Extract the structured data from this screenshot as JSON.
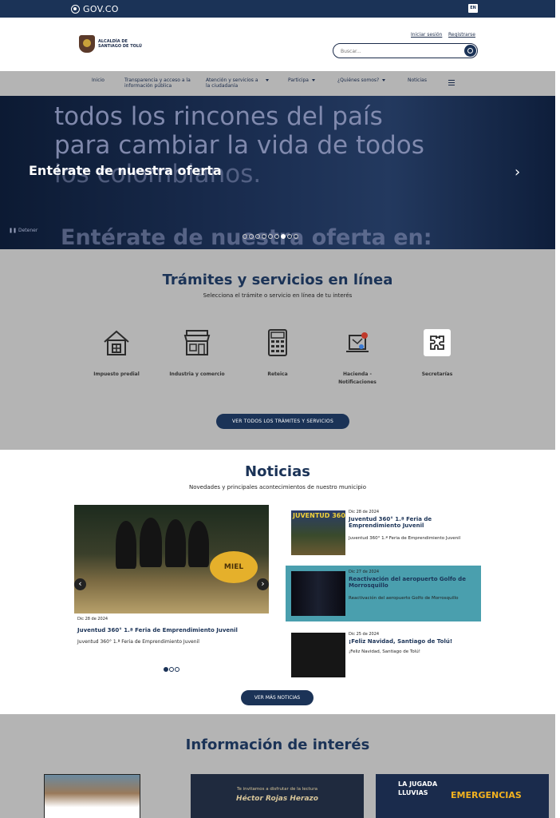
{
  "govbar": {
    "logo_text": "GOV.CO",
    "lang": "EN"
  },
  "header": {
    "logo_line1": "ALCALDÍA DE",
    "logo_line2": "SANTIAGO DE TOLÚ",
    "login": "Iniciar sesión",
    "register": "Registrarse",
    "search_placeholder": "Buscar..."
  },
  "nav": {
    "items": [
      {
        "label": "Inicio"
      },
      {
        "label": "Transparencia y acceso a la información pública"
      },
      {
        "label": "Atención y servicios a la ciudadanía"
      },
      {
        "label": "Participa"
      },
      {
        "label": "¿Quiénes somos?"
      },
      {
        "label": "Noticias"
      }
    ]
  },
  "hero": {
    "bg_line1": "todos los rincones del país",
    "bg_line2": "para cambiar la vida de todos",
    "bg_line3": "los colombianos.",
    "bg_line4": "Entérate de nuestra oferta en:",
    "title": "Entérate de nuestra oferta",
    "stop_label": "Detener",
    "slides": 9,
    "active_slide": 6
  },
  "tramites": {
    "title": "Trámites y servicios en línea",
    "subtitle": "Selecciona el trámite o servicio en línea de tu interés",
    "services": [
      {
        "label": "Impuesto predial",
        "icon": "house-icon"
      },
      {
        "label": "Industria y comercio",
        "icon": "store-icon"
      },
      {
        "label": "Reteica",
        "icon": "calculator-icon"
      },
      {
        "label": "Hacienda - Notificaciones",
        "icon": "notification-icon"
      },
      {
        "label": "Secretarías",
        "icon": "puzzle-icon"
      }
    ],
    "button": "VER TODOS LOS TRÁMITES Y SERVICIOS"
  },
  "noticias": {
    "title": "Noticias",
    "subtitle": "Novedades y principales acontecimientos de nuestro municipio",
    "main": {
      "date": "Dic 28 de 2024",
      "title": "Juventud 360° 1.ª Feria de Emprendimiento Juvenil",
      "desc": "Juventud 360° 1.ª Feria de Emprendimiento Juvenil",
      "sign": "MIEL"
    },
    "side": [
      {
        "date": "Dic 28 de 2024",
        "title": "Juventud 360° 1.ª Feria de Emprendimiento Juvenil",
        "desc": "Juventud 360° 1.ª Feria de Emprendimiento Juvenil",
        "thumb_text": "JUVENTUD 360"
      },
      {
        "date": "Dic 27 de 2024",
        "title": "Reactivación del aeropuerto Golfo de Morrosquillo",
        "desc": "Reactivación del aeropuerto Golfo de Morrosquillo"
      },
      {
        "date": "Dic 25 de 2024",
        "title": "¡Feliz Navidad, Santiago de Tolú!",
        "desc": "¡Feliz Navidad, Santiago de Tolú!"
      }
    ],
    "dots": 3,
    "active_dot": 0,
    "button": "VER MÁS NOTICIAS"
  },
  "info": {
    "title": "Información de interés",
    "card2_text": "Te invitamos a disfrutar de la lectura",
    "card2_name": "Héctor Rojas Herazo",
    "card3_line1": "LA JUGADA",
    "card3_line2": "LLUVIAS",
    "card3_line3": "EMERGENCIAS"
  }
}
